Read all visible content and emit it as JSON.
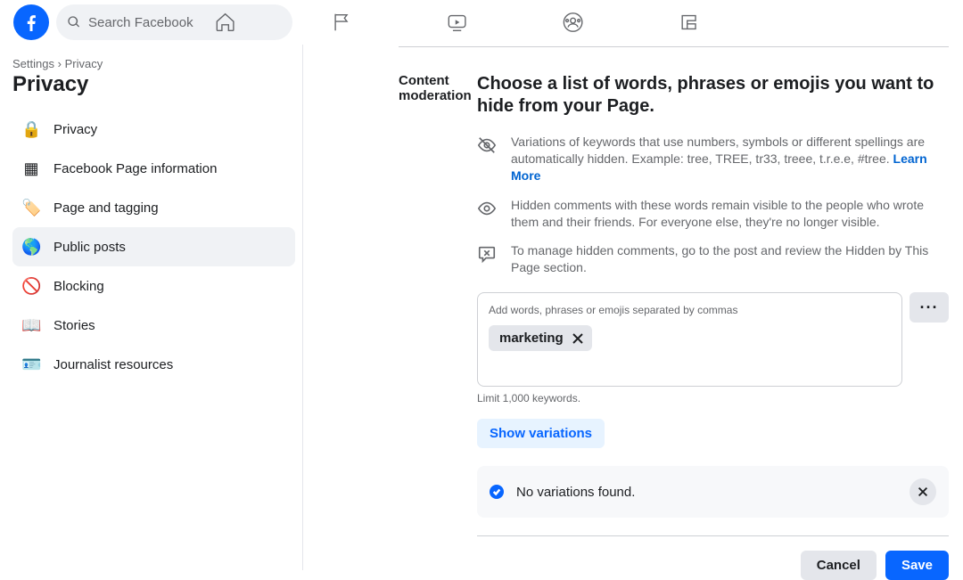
{
  "header": {
    "search_placeholder": "Search Facebook"
  },
  "breadcrumb": {
    "settings": "Settings",
    "sep": "›",
    "privacy": "Privacy"
  },
  "page_title": "Privacy",
  "sidebar": {
    "items": [
      {
        "label": "Privacy"
      },
      {
        "label": "Facebook Page information"
      },
      {
        "label": "Page and tagging"
      },
      {
        "label": "Public posts"
      },
      {
        "label": "Blocking"
      },
      {
        "label": "Stories"
      },
      {
        "label": "Journalist resources"
      }
    ]
  },
  "section": {
    "label": "Content moderation",
    "heading": "Choose a list of words, phrases or emojis you want to hide from your Page.",
    "info1": "Variations of keywords that use numbers, symbols or different spellings are automatically hidden. Example: tree, TREE, tr33, treee, t.r.e.e, #tree. ",
    "info1_link": "Learn More",
    "info2": "Hidden comments with these words remain visible to the people who wrote them and their friends. For everyone else, they're no longer visible.",
    "info3": "To manage hidden comments, go to the post and review the Hidden by This Page section.",
    "input_placeholder": "Add words, phrases or emojis separated by commas",
    "chip": "marketing",
    "limit": "Limit 1,000 keywords.",
    "show_variations": "Show variations",
    "alert": "No variations found.",
    "cancel": "Cancel",
    "save": "Save"
  }
}
